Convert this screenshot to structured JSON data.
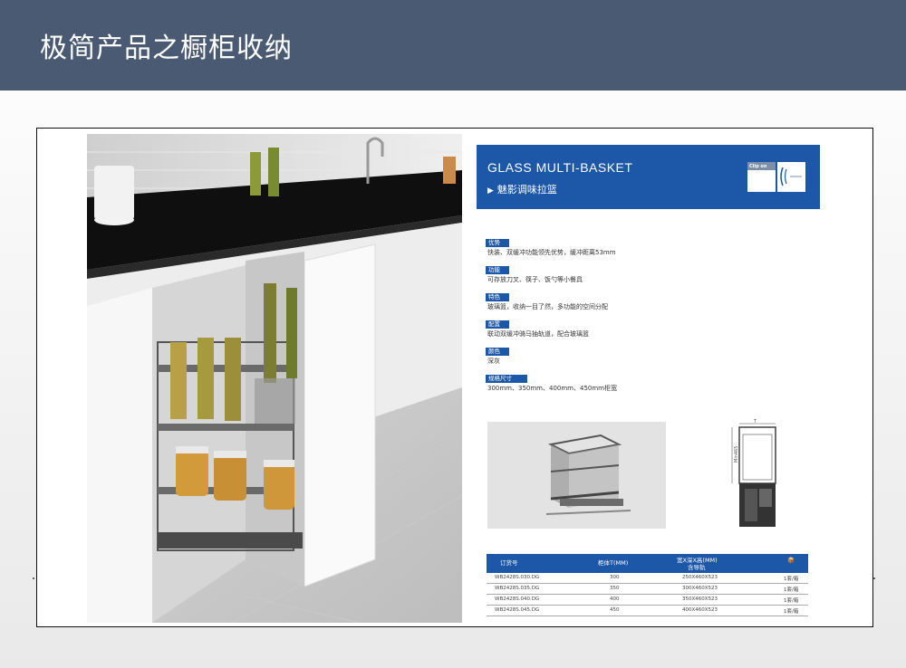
{
  "header": {
    "title": "极简产品之橱柜收纳"
  },
  "product": {
    "name_en": "GLASS MULTI-BASKET",
    "name_cn": "魅影调味拉篮",
    "logo_text": "Clip on"
  },
  "specs": [
    {
      "label": "优势",
      "value": "快装、双缓冲功能领先优势，缓冲距离53mm"
    },
    {
      "label": "功能",
      "value": "可存放刀叉、筷子、饭勺等小餐具"
    },
    {
      "label": "特色",
      "value": "玻璃篮，收纳一目了然，多功能的空间分配"
    },
    {
      "label": "配置",
      "value": "联动双缓冲骑马抽轨道，配合玻璃篮"
    },
    {
      "label": "颜色",
      "value": "深灰"
    },
    {
      "label": "规格尺寸",
      "value": "300mm、350mm、400mm、450mm柜宽"
    }
  ],
  "diagram": {
    "dim_label": "Min465",
    "top_label": "T"
  },
  "table": {
    "headers": {
      "code": "订货号",
      "cabinet": "柜体T(MM)",
      "size": "宽X深X高(MM)",
      "size_sub": "含导轨",
      "pack": "📦"
    },
    "rows": [
      {
        "code": "WB2428S.030.DG",
        "cabinet": "300",
        "size": "250X460X523",
        "pack": "1套/箱"
      },
      {
        "code": "WB2428S.035.DG",
        "cabinet": "350",
        "size": "300X460X523",
        "pack": "1套/箱"
      },
      {
        "code": "WB2428S.040.DG",
        "cabinet": "400",
        "size": "350X460X523",
        "pack": "1套/箱"
      },
      {
        "code": "WB2428S.045.DG",
        "cabinet": "450",
        "size": "400X460X523",
        "pack": "1套/箱"
      }
    ]
  },
  "colors": {
    "header_bg": "#4a5a72",
    "brand_blue": "#1d57a8"
  }
}
